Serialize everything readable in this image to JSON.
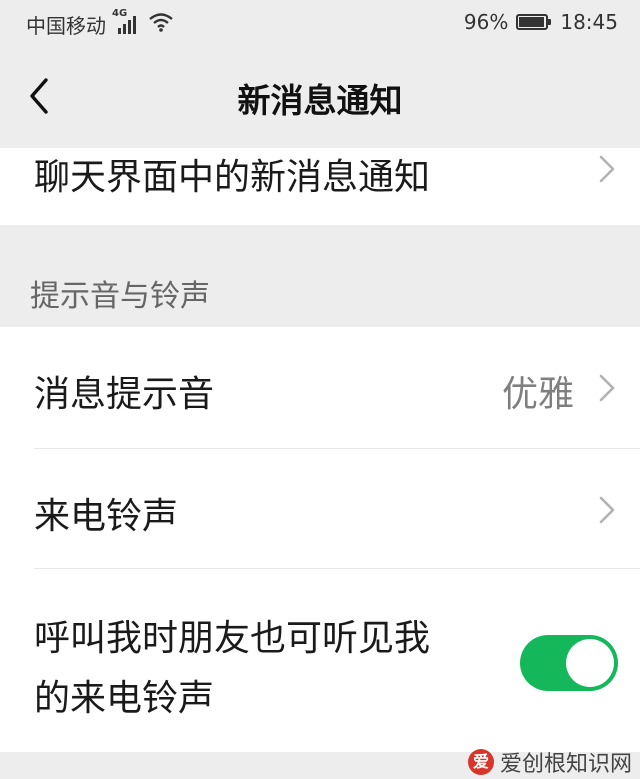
{
  "status_bar": {
    "carrier": "中国移动",
    "network_type": "4G",
    "battery_percent_text": "96%",
    "battery_level": 0.96,
    "time": "18:45",
    "icons": [
      "signal-icon",
      "wifi-icon",
      "battery-icon"
    ]
  },
  "nav": {
    "back_icon": "chevron-left-icon",
    "title": "新消息通知"
  },
  "rows": {
    "chat_notification": {
      "label": "聊天界面中的新消息通知"
    },
    "section_header": "提示音与铃声",
    "message_sound": {
      "label": "消息提示音",
      "value": "优雅"
    },
    "ringtone": {
      "label": "来电铃声"
    },
    "friend_hear_ringtone": {
      "label_line1": "呼叫我时朋友也可听见我",
      "label_line2": "的来电铃声",
      "enabled": true
    }
  },
  "watermark": {
    "logo_char": "爱",
    "text": "爱创根知识网"
  },
  "colors": {
    "background": "#ededed",
    "row_background": "#ffffff",
    "toggle_on": "#14b85b",
    "secondary_text": "#7f7f7f"
  }
}
